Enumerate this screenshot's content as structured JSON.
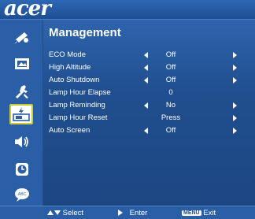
{
  "brand": {
    "logo_text": "acer"
  },
  "sidebar": {
    "items": [
      {
        "icon": "image-settings-icon"
      },
      {
        "icon": "screen-icon"
      },
      {
        "icon": "tools-icon"
      },
      {
        "icon": "management-icon",
        "active": true
      },
      {
        "icon": "audio-icon"
      },
      {
        "icon": "timer-icon"
      },
      {
        "icon": "language-icon"
      }
    ]
  },
  "main": {
    "title": "Management",
    "rows": [
      {
        "label": "ECO Mode",
        "value": "Off",
        "arrows": true
      },
      {
        "label": "High Altitude",
        "value": "Off",
        "arrows": true
      },
      {
        "label": "Auto Shutdown",
        "value": "Off",
        "arrows": true
      },
      {
        "label": "Lamp Hour Elapse",
        "value": "0",
        "arrows": false
      },
      {
        "label": "Lamp Reminding",
        "value": "No",
        "arrows": true
      },
      {
        "label": "Lamp Hour Reset",
        "value": "Press",
        "arrows": false,
        "right_arrow": true
      },
      {
        "label": "Auto Screen",
        "value": "Off",
        "arrows": true
      }
    ]
  },
  "footer": {
    "select_label": "Select",
    "enter_label": "Enter",
    "menu_key": "MENU",
    "exit_label": "Exit"
  },
  "colors": {
    "background": "#204d8b",
    "sidebar": "#2a5ea6",
    "active_border": "#c9ca3b",
    "text": "#ffffff"
  }
}
